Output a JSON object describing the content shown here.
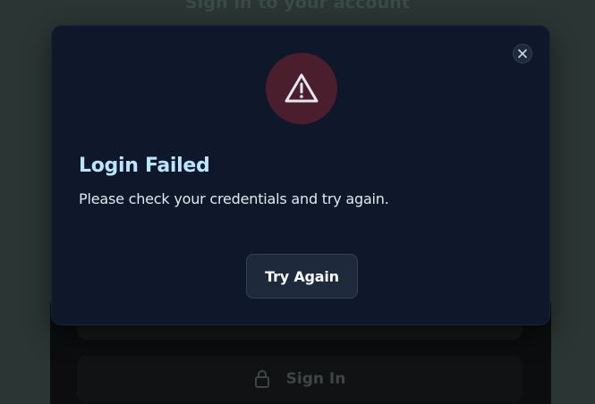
{
  "background": {
    "title": "Sign in to your account",
    "submit_icon": "lock-icon",
    "submit_label": "Sign In"
  },
  "modal": {
    "icon": "warning-triangle-icon",
    "close_icon": "close-icon",
    "title": "Login Failed",
    "message": "Please check your credentials and try again.",
    "button_label": "Try Again"
  },
  "colors": {
    "modal_bg": "#0f172a",
    "title": "#bae6fd",
    "alert_circle": "#4a1e2c",
    "alert_icon": "#e2e8f0",
    "button_bg": "#1e293b"
  }
}
